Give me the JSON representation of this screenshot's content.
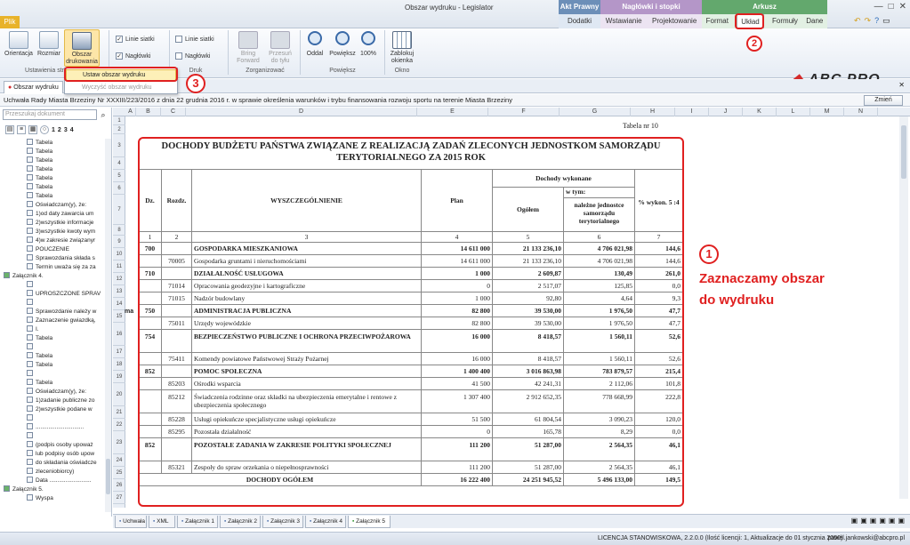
{
  "app": {
    "title": "Obszar wydruku - Legislator",
    "plik": "Plik"
  },
  "contexts": [
    {
      "header": "Akt Prawny",
      "tabs": [
        "Dodatki"
      ]
    },
    {
      "header": "Nagłówki i stopki",
      "tabs": [
        "Wstawianie",
        "Projektowanie"
      ]
    },
    {
      "header": "Arkusz",
      "tabs": [
        "Format",
        "Układ",
        "Formuły",
        "Dane"
      ]
    }
  ],
  "ribbon": {
    "orientacja": "Orientacja",
    "rozmiar": "Rozmiar",
    "obszar": "Obszar drukowania",
    "ustawienia_group": "Ustawienia str",
    "linie_siatki": "Linie siatki",
    "naglowki": "Nagłówki",
    "linie_siatki2": "Linie siatki",
    "naglowki2": "Nagłówki",
    "druk_group": "Druk",
    "bring_forward": "Bring Forward",
    "przesun": "Przesuń do tyłu",
    "zorganizowac": "Zorganizować",
    "oddal": "Oddal",
    "powieksz": "Powiększ",
    "p100": "100%",
    "powieksz_group": "Powiększ",
    "zablokuj": "Zablokuj okienka",
    "okno_group": "Okno"
  },
  "logo": {
    "abc": "ABC",
    "pro": "PRO"
  },
  "dropdown": {
    "item1": "Ustaw obszar wydruku",
    "item2": "Wyczyść obszar wydruku"
  },
  "annotations": {
    "n1": "1",
    "n2": "2",
    "n3": "3",
    "text1": "Zaznaczamy obszar",
    "text2": "do wydruku"
  },
  "doc_tab": "Obszar wydruku",
  "uchwala": "Uchwała Rady Miasta Brzeziny Nr XXXIII/223/2016 z dnia 22 grudnia 2016 r. w sprawie określenia warunków i trybu finansowania rozwoju sportu na terenie Miasta Brzeziny",
  "zmien": "Zmień",
  "search_placeholder": "Przeszukaj dokument",
  "lp_tools": [
    "1",
    "2",
    "3",
    "4"
  ],
  "tree": [
    "Tabela",
    "Tabela",
    "Tabela",
    "Tabela",
    "Tabela",
    "Tabela",
    "Tabela",
    "Oświadczam(y), że:",
    "1)od daty zawarcia um",
    "2)wszystkie informacje",
    "3)wszystkie kwoty wym",
    "4)w zakresie związanyr",
    "POUCZENIE",
    "Sprawozdania składa s",
    "Termin uważa się za za",
    "Załącznik 4.",
    "",
    "UPROSZCZONE SPRAV",
    "",
    "Sprawozdanie należy w",
    "Zaznaczenie gwiazdką,",
    "I.",
    "Tabela",
    "",
    "Tabela",
    "Tabela",
    "",
    "Tabela",
    "Oświadczam(y), że:",
    "1)zadanie publiczne zo",
    "2)wszystkie podane w",
    "",
    "..............................",
    "",
    "(podpis osoby upoważ",
    "lub podpisy osób upow",
    "do składania oświadcze",
    "zleceniobiorcy)",
    "Data ..........................",
    "Załącznik 5.",
    "Wyspa"
  ],
  "columns": [
    "A",
    "B",
    "C",
    "D",
    "E",
    "F",
    "G",
    "H",
    "I",
    "J",
    "K",
    "L",
    "M",
    "N"
  ],
  "rows": [
    "1",
    "2",
    "3",
    "4",
    "5",
    "6",
    "7",
    "8",
    "9",
    "10",
    "11",
    "12",
    "13",
    "14",
    "15",
    "16",
    "17",
    "18",
    "19",
    "20",
    "21",
    "22",
    "23",
    "24",
    "25",
    "26",
    "27"
  ],
  "tabela_nr": "Tabela nr 10",
  "table": {
    "title": "DOCHODY BUDŻETU PAŃSTWA ZWIĄZANE Z REALIZACJĄ ZADAŃ ZLECONYCH JEDNOSTKOM SAMORZĄDU TERYTORIALNEGO ZA 2015 ROK",
    "headers": {
      "dz": "Dz.",
      "rozdz": "Rozdz.",
      "wyszcz": "WYSZCZEGÓLNIENIE",
      "plan": "Plan",
      "dochody": "Dochody wykonane",
      "wtym": "w tym:",
      "ogolem": "Ogółem",
      "nalezne": "należne jednostce samorządu terytorialnego",
      "proc": "% wykon. 5 :4"
    },
    "nums": [
      "1",
      "2",
      "3",
      "4",
      "5",
      "6",
      "7"
    ],
    "rows": [
      {
        "dz": "700",
        "rozdz": "",
        "name": "GOSPODARKA MIESZKANIOWA",
        "plan": "14 611 000",
        "ogolem": "21 133 236,10",
        "nalezne": "4 706 021,98",
        "proc": "144,6",
        "bold": true
      },
      {
        "dz": "",
        "rozdz": "70005",
        "name": "Gospodarka gruntami i nieruchomościami",
        "plan": "14 611 000",
        "ogolem": "21 133 236,10",
        "nalezne": "4 706 021,98",
        "proc": "144,6",
        "bold": false
      },
      {
        "dz": "710",
        "rozdz": "",
        "name": "DZIAŁALNOŚĆ USŁUGOWA",
        "plan": "1 000",
        "ogolem": "2 609,87",
        "nalezne": "130,49",
        "proc": "261,0",
        "bold": true
      },
      {
        "dz": "",
        "rozdz": "71014",
        "name": "Opracowania geodezyjne i kartograficzne",
        "plan": "0",
        "ogolem": "2 517,07",
        "nalezne": "125,85",
        "proc": "0,0",
        "bold": false
      },
      {
        "dz": "",
        "rozdz": "71015",
        "name": "Nadzór budowlany",
        "plan": "1 000",
        "ogolem": "92,80",
        "nalezne": "4,64",
        "proc": "9,3",
        "bold": false
      },
      {
        "dz": "750",
        "rozdz": "",
        "name": "ADMINISTRACJA PUBLICZNA",
        "plan": "82 800",
        "ogolem": "39 530,00",
        "nalezne": "1 976,50",
        "proc": "47,7",
        "bold": true
      },
      {
        "dz": "",
        "rozdz": "75011",
        "name": "Urzędy wojewódzkie",
        "plan": "82 800",
        "ogolem": "39 530,00",
        "nalezne": "1 976,50",
        "proc": "47,7",
        "bold": false
      },
      {
        "dz": "754",
        "rozdz": "",
        "name": "BEZPIECZEŃSTWO PUBLICZNE I OCHRONA PRZECIWPOŻAROWA",
        "plan": "16 000",
        "ogolem": "8 418,57",
        "nalezne": "1 560,11",
        "proc": "52,6",
        "bold": true
      },
      {
        "dz": "",
        "rozdz": "75411",
        "name": "Komendy powiatowe Państwowej Straży Pożarnej",
        "plan": "16 000",
        "ogolem": "8 418,57",
        "nalezne": "1 560,11",
        "proc": "52,6",
        "bold": false
      },
      {
        "dz": "852",
        "rozdz": "",
        "name": "POMOC SPOŁECZNA",
        "plan": "1 400 400",
        "ogolem": "3 016 863,98",
        "nalezne": "783 879,57",
        "proc": "215,4",
        "bold": true
      },
      {
        "dz": "",
        "rozdz": "85203",
        "name": "Ośrodki wsparcia",
        "plan": "41 500",
        "ogolem": "42 241,31",
        "nalezne": "2 112,06",
        "proc": "101,8",
        "bold": false
      },
      {
        "dz": "",
        "rozdz": "85212",
        "name": "Świadczenia rodzinne oraz składki na ubezpieczenia emerytalne i rentowe z ubezpieczenia społecznego",
        "plan": "1 307 400",
        "ogolem": "2 912 652,35",
        "nalezne": "778 668,99",
        "proc": "222,8",
        "bold": false
      },
      {
        "dz": "",
        "rozdz": "85228",
        "name": "Usługi opiekuńcze specjalistyczne usługi opiekuńcze",
        "plan": "51 500",
        "ogolem": "61 804,54",
        "nalezne": "3 090,23",
        "proc": "120,0",
        "bold": false
      },
      {
        "dz": "",
        "rozdz": "85295",
        "name": "Pozostała działalność",
        "plan": "0",
        "ogolem": "165,78",
        "nalezne": "8,29",
        "proc": "0,0",
        "bold": false
      },
      {
        "dz": "852",
        "rozdz": "",
        "name": "POZOSTAŁE ZADANIA W ZAKRESIE POLITYKI SPOŁECZNEJ",
        "plan": "111 200",
        "ogolem": "51 287,00",
        "nalezne": "2 564,35",
        "proc": "46,1",
        "bold": true
      },
      {
        "dz": "",
        "rozdz": "85321",
        "name": "Zespoły do spraw orzekania o niepełnosprawności",
        "plan": "111 200",
        "ogolem": "51 287,00",
        "nalezne": "2 564,35",
        "proc": "46,1",
        "bold": false
      },
      {
        "dz": "",
        "rozdz": "",
        "name": "DOCHODY OGÓŁEM",
        "plan": "16 222 400",
        "ogolem": "24 251 945,52",
        "nalezne": "5 496 133,00",
        "proc": "149,5",
        "bold": true,
        "total": true
      }
    ]
  },
  "row_label_ma": "ma",
  "sheet_tabs": [
    "Uchwała",
    "XML",
    "Załącznik 1",
    "Załącznik 2",
    "Załącznik 3",
    "Załącznik 4",
    "Załącznik 5"
  ],
  "status": {
    "licencja": "LICENCJA STANOWISKOWA, 2.2.0.0 (Ilość licencji: 1, Aktualizacje do 01 stycznia 2050)",
    "user": "pawel.jankowski@abcpro.pl"
  }
}
